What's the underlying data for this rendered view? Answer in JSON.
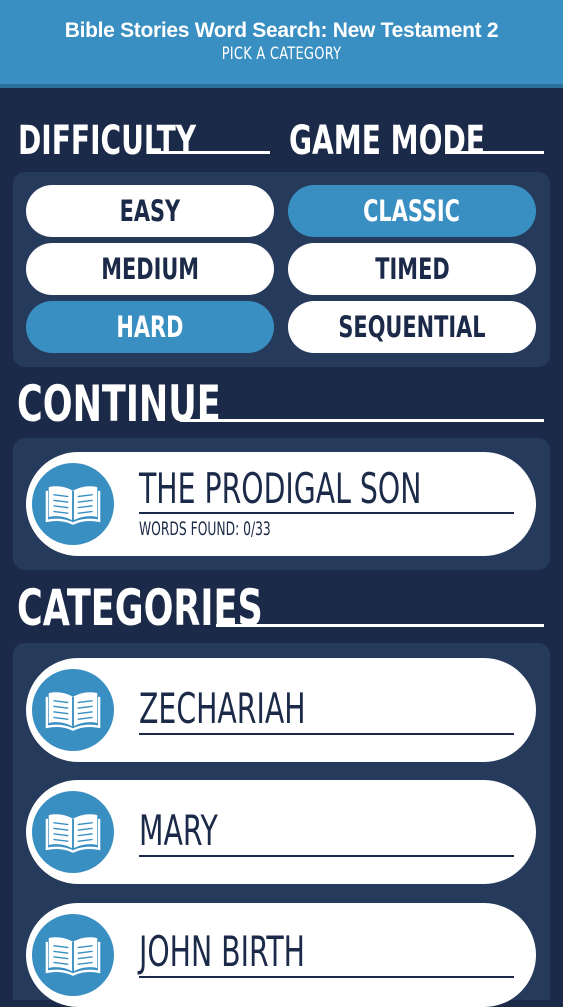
{
  "header": {
    "title": "Bible Stories Word Search: New Testament 2",
    "subtitle": "PICK A CATEGORY"
  },
  "difficulty": {
    "heading": "DIFFICULTY",
    "options": [
      {
        "label": "EASY",
        "selected": false
      },
      {
        "label": "MEDIUM",
        "selected": false
      },
      {
        "label": "HARD",
        "selected": true
      }
    ]
  },
  "game_mode": {
    "heading": "GAME MODE",
    "options": [
      {
        "label": "CLASSIC",
        "selected": true
      },
      {
        "label": "TIMED",
        "selected": false
      },
      {
        "label": "SEQUENTIAL",
        "selected": false
      }
    ]
  },
  "continue": {
    "heading": "CONTINUE",
    "item": {
      "title": "THE PRODIGAL SON",
      "progress": "WORDS FOUND: 0/33",
      "icon": "open-book-icon"
    }
  },
  "categories": {
    "heading": "CATEGORIES",
    "items": [
      {
        "title": "ZECHARIAH",
        "icon": "open-book-icon"
      },
      {
        "title": "MARY",
        "icon": "open-book-icon"
      },
      {
        "title": "JOHN BIRTH",
        "icon": "open-book-icon"
      }
    ]
  },
  "colors": {
    "background": "#1b2a48",
    "panel": "#263a5c",
    "accent": "#3a8fc2",
    "card": "#ffffff"
  }
}
